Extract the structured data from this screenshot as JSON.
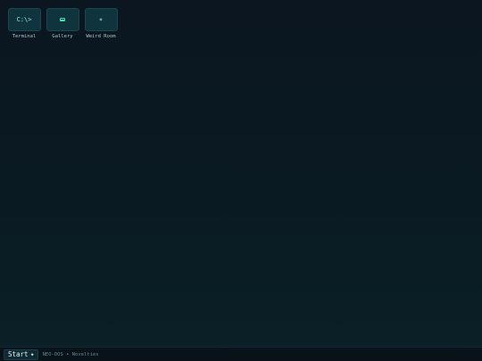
{
  "desktop": {
    "icons": [
      {
        "label": "Terminal",
        "glyph": "C:\\>",
        "icon": "terminal-icon"
      },
      {
        "label": "Gallery",
        "glyph": "",
        "icon": "gallery-icon"
      },
      {
        "label": "Weird Room",
        "glyph": "✶",
        "icon": "weird-room-icon"
      }
    ]
  },
  "taskbar": {
    "start_label": "Start",
    "start_glyph": "◆",
    "title": "NEO-DOS • Novelties"
  },
  "colors": {
    "background_top": "#0b1620",
    "background_bottom": "#0b2028",
    "accent": "#3fe0b0",
    "tile": "#10343d"
  }
}
